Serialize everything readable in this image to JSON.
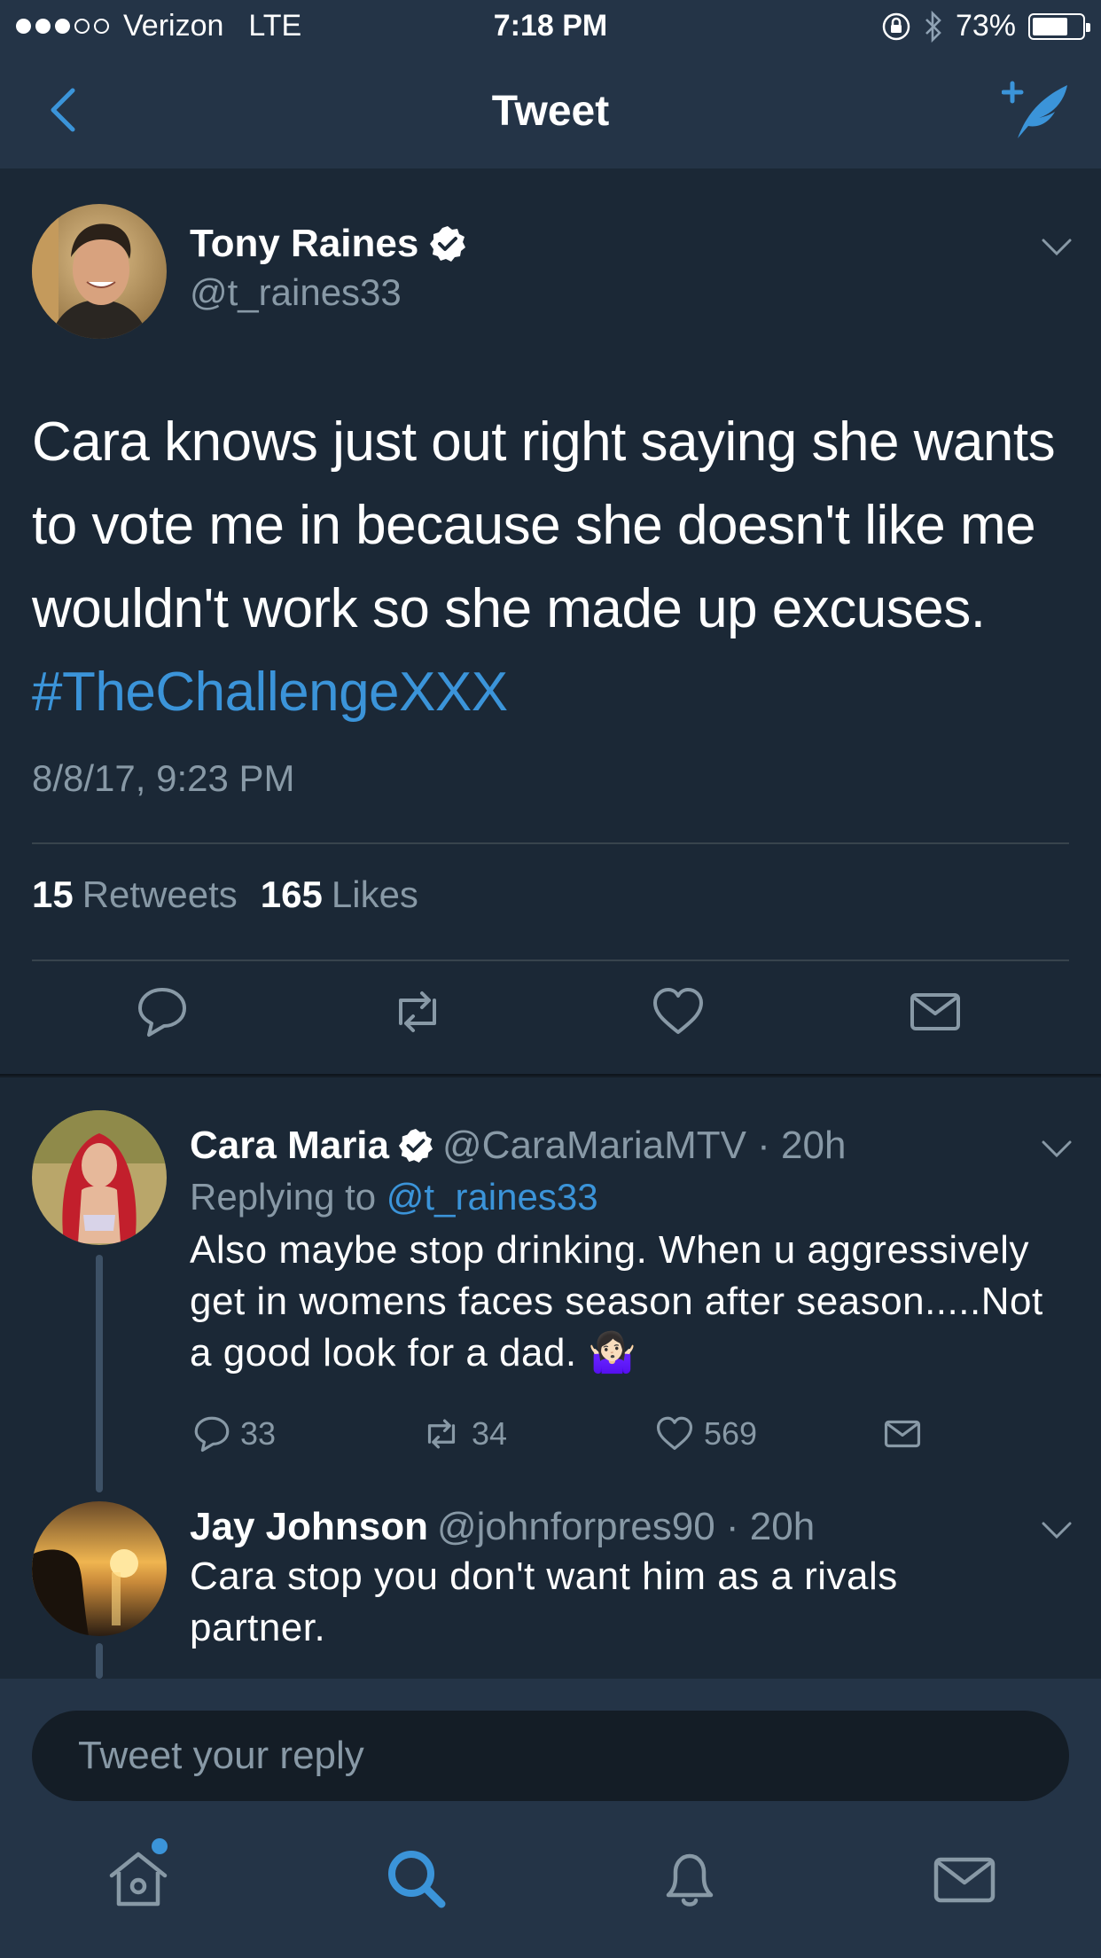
{
  "status_bar": {
    "carrier": "Verizon",
    "network": "LTE",
    "time": "7:18 PM",
    "battery": "73%",
    "battery_level": 0.73
  },
  "nav": {
    "title": "Tweet"
  },
  "main_tweet": {
    "author_name": "Tony Raines",
    "author_handle": "@t_raines33",
    "text": "Cara knows just out right saying she wants to vote me in because she doesn't like me wouldn't work so she made up excuses. ",
    "hashtag": "#TheChallengeXXX",
    "timestamp": "8/8/17, 9:23 PM",
    "retweets_count": "15",
    "retweets_label": "Retweets",
    "likes_count": "165",
    "likes_label": "Likes"
  },
  "replies": [
    {
      "name": "Cara Maria",
      "verified": true,
      "meta": "@CaraMariaMTV · 20h",
      "replying_prefix": "Replying to",
      "replying_to": "@t_raines33",
      "text": "Also maybe stop drinking. When u aggressively get in womens faces season after season.....Not a good look for a dad. 🤷🏻‍♀️",
      "reply_count": "33",
      "retweet_count": "34",
      "like_count": "569"
    },
    {
      "name": "Jay Johnson",
      "verified": false,
      "meta": "@johnforpres90 · 20h",
      "text": "Cara stop you don't want him as a rivals partner."
    }
  ],
  "reply_bar": {
    "placeholder": "Tweet your reply"
  },
  "tabbar": {
    "items": [
      "home-icon",
      "search-icon",
      "notifications-icon",
      "messages-icon"
    ]
  },
  "colors": {
    "accent": "#3b94d9",
    "background": "#1b2836",
    "bar": "#243447",
    "muted": "#8899a6"
  }
}
